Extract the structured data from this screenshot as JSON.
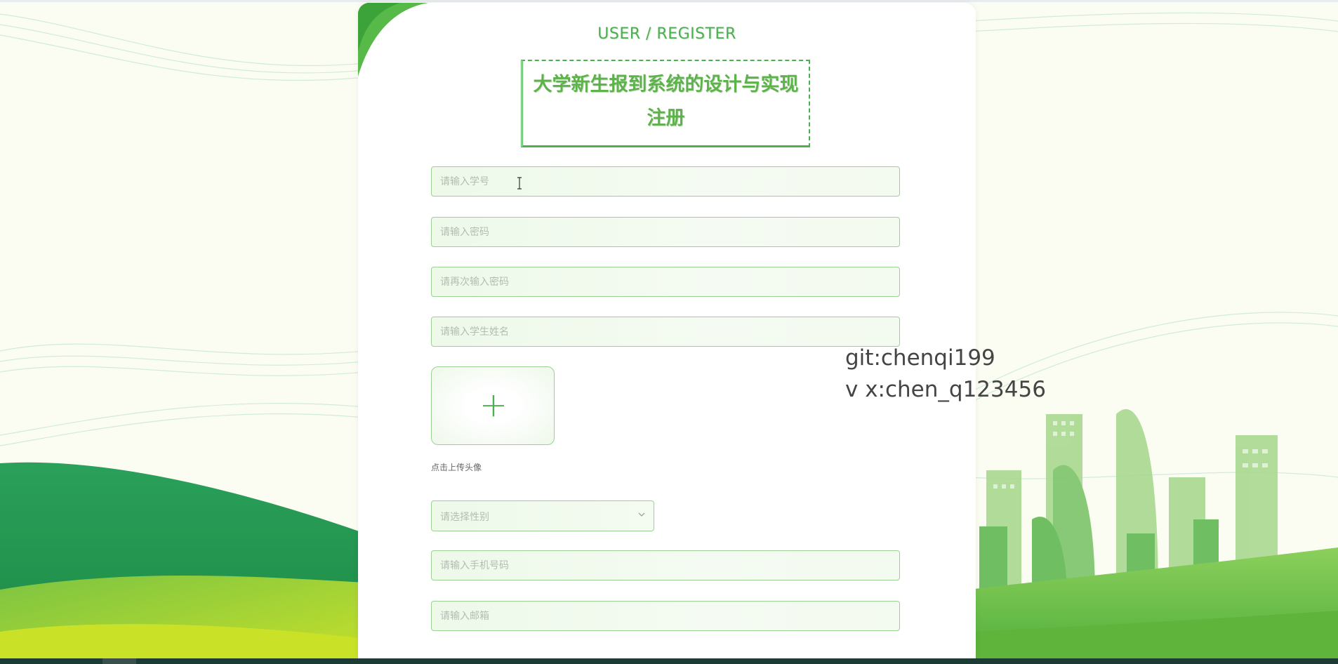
{
  "header": {
    "subtitle": "USER / REGISTER",
    "title_line1": "大学新生报到系统的设计与实现",
    "title_line2": "注册"
  },
  "form": {
    "student_id": {
      "placeholder": "请输入学号",
      "value": ""
    },
    "password": {
      "placeholder": "请输入密码",
      "value": ""
    },
    "password_confirm": {
      "placeholder": "请再次输入密码",
      "value": ""
    },
    "student_name": {
      "placeholder": "请输入学生姓名",
      "value": ""
    },
    "avatar": {
      "label": "点击上传头像",
      "plus_icon": "plus-icon"
    },
    "gender": {
      "placeholder": "请选择性别",
      "options_visible": [],
      "chevron_icon": "chevron-down-icon"
    },
    "phone": {
      "placeholder": "请输入手机号码",
      "value": ""
    },
    "email": {
      "placeholder": "请输入邮箱",
      "value": ""
    }
  },
  "watermark": {
    "line1": "git:chenqi199",
    "line2": "v x:chen_q123456"
  },
  "colors": {
    "accent": "#4caf50",
    "field_border": "#9bd294",
    "field_bg": "#eef9ea",
    "bottom_bar": "#1c3b35"
  }
}
